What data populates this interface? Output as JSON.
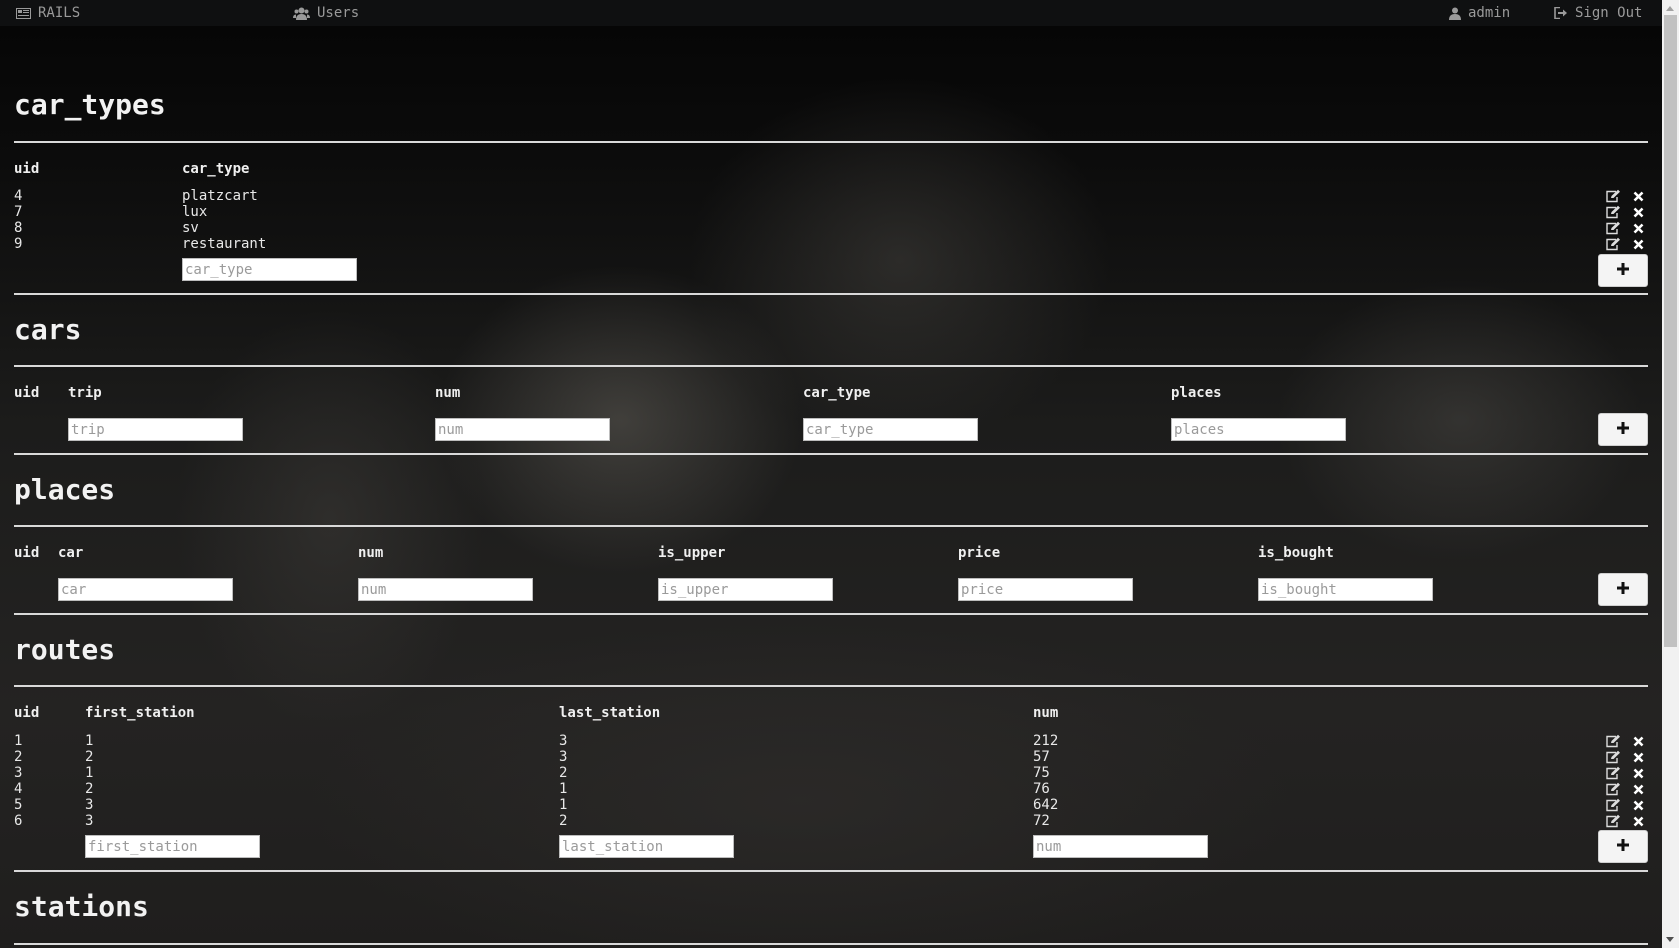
{
  "nav": {
    "brand": "RAILS",
    "users": "Users",
    "user": "admin",
    "sign_out": "Sign Out"
  },
  "car_types": {
    "title": "car_types",
    "headers": [
      "uid",
      "car_type"
    ],
    "rows": [
      [
        "4",
        "platzcart"
      ],
      [
        "7",
        "lux"
      ],
      [
        "8",
        "sv"
      ],
      [
        "9",
        "restaurant"
      ]
    ],
    "placeholders": [
      "car_type"
    ]
  },
  "cars": {
    "title": "cars",
    "headers": [
      "uid",
      "trip",
      "num",
      "car_type",
      "places"
    ],
    "placeholders": [
      "trip",
      "num",
      "car_type",
      "places"
    ]
  },
  "places": {
    "title": "places",
    "headers": [
      "uid",
      "car",
      "num",
      "is_upper",
      "price",
      "is_bought"
    ],
    "placeholders": [
      "car",
      "num",
      "is_upper",
      "price",
      "is_bought"
    ]
  },
  "routes": {
    "title": "routes",
    "headers": [
      "uid",
      "first_station",
      "last_station",
      "num"
    ],
    "rows": [
      [
        "1",
        "1",
        "3",
        "212"
      ],
      [
        "2",
        "2",
        "3",
        "57"
      ],
      [
        "3",
        "1",
        "2",
        "75"
      ],
      [
        "4",
        "2",
        "1",
        "76"
      ],
      [
        "5",
        "3",
        "1",
        "642"
      ],
      [
        "6",
        "3",
        "2",
        "72"
      ]
    ],
    "placeholders": [
      "first_station",
      "last_station",
      "num"
    ]
  },
  "stations": {
    "title": "stations"
  },
  "icons": {
    "edit": "edit-icon",
    "delete": "close-icon",
    "add": "plus-icon",
    "brand": "newspaper-icon",
    "users": "users-icon",
    "user": "user-icon",
    "sign_out": "sign-out-icon"
  }
}
